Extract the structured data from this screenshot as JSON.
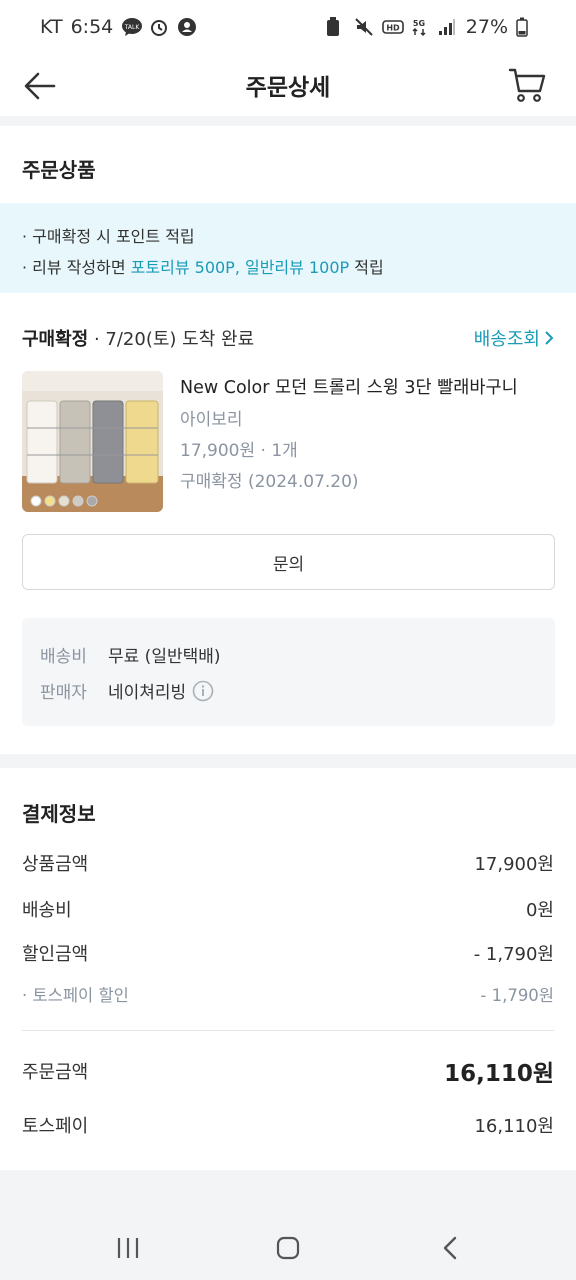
{
  "status_bar": {
    "carrier": "KT",
    "time": "6:54",
    "battery": "27%",
    "icons": [
      "talk-icon",
      "alarm-icon",
      "account-icon",
      "battery-saver-icon",
      "mute-icon",
      "hd-icon",
      "5g-icon",
      "signal-icon",
      "battery-icon"
    ]
  },
  "appbar": {
    "title": "주문상세",
    "back_icon": "arrow-left-icon",
    "cart_icon": "cart-icon"
  },
  "order_products": {
    "title": "주문상품",
    "notice": {
      "line1": "구매확정 시 포인트 적립",
      "line2_prefix": "리뷰 작성하면 ",
      "line2_highlight": "포토리뷰 500P, 일반리뷰 100P",
      "line2_suffix": " 적립"
    },
    "status_label": "구매확정",
    "status_detail": " · 7/20(토) 도착 완료",
    "track_label": "배송조회",
    "product": {
      "name": "New Color 모던 트롤리 스윙 3단 빨래바구니",
      "option": "아이보리",
      "price_qty": "17,900원 · 1개",
      "confirm_status": "구매확정 (2024.07.20)",
      "swatches": [
        "#ffffff",
        "#f3e08a",
        "#e6e0d2",
        "#cfcac2",
        "#a9a9a9"
      ]
    },
    "inquiry_button": "문의",
    "shipping": {
      "fee_label": "배송비",
      "fee_value": "무료 (일반택배)",
      "seller_label": "판매자",
      "seller_value": "네이쳐리빙"
    }
  },
  "payment": {
    "title": "결제정보",
    "rows": [
      {
        "label": "상품금액",
        "value": "17,900원"
      },
      {
        "label": "배송비",
        "value": "0원"
      },
      {
        "label": "할인금액",
        "value": "- 1,790원"
      }
    ],
    "sub_row": {
      "label": "· 토스페이 할인",
      "value": "- 1,790원"
    },
    "total": {
      "label": "주문금액",
      "value": "16,110원"
    },
    "method": {
      "label": "토스페이",
      "value": "16,110원"
    }
  },
  "nav": {
    "recents_icon": "recents-icon",
    "home_icon": "home-icon",
    "back_icon": "back-chevron-icon"
  },
  "colors": {
    "accent": "#1a9bb8",
    "notice_bg": "#e8f7fb",
    "muted": "#8b95a1"
  }
}
